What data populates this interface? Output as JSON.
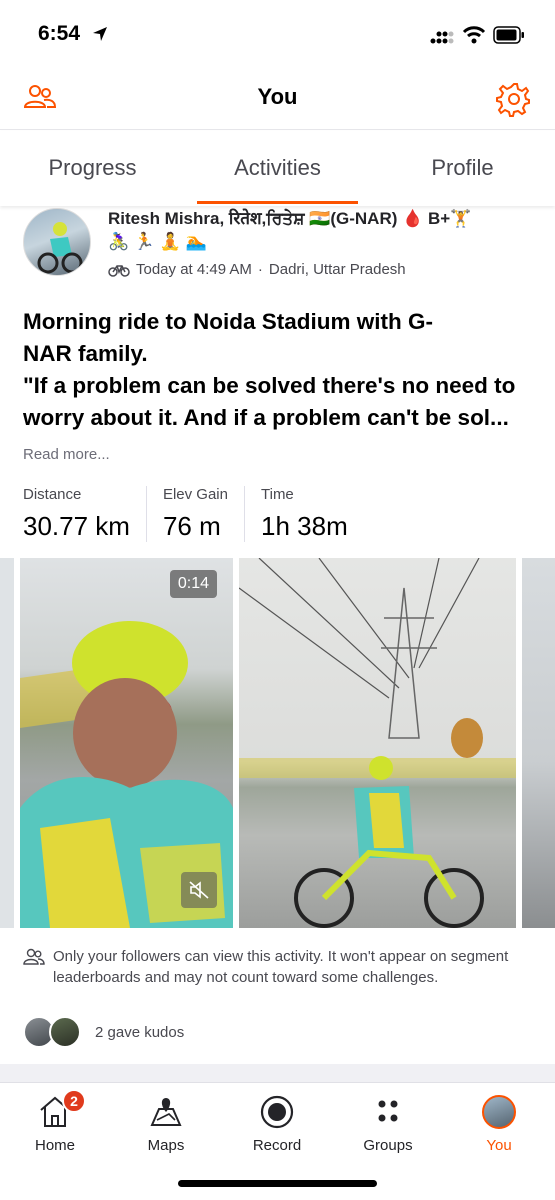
{
  "status_bar": {
    "time": "6:54"
  },
  "header": {
    "title": "You"
  },
  "tabs": [
    {
      "label": "Progress"
    },
    {
      "label": "Activities"
    },
    {
      "label": "Profile"
    }
  ],
  "activity": {
    "athlete_name": "Ritesh Mishra, रितेश,ਰਿਤੇਸ਼ 🇮🇳(G-NAR) 🩸 B+🏋️",
    "sport_emojis": "🚴‍♀️ 🏃 🧘 🏊",
    "timestamp": "Today at 4:49 AM",
    "location": "Dadri, Uttar Pradesh",
    "title": "Morning ride to Noida Stadium with G-\nNAR family.\n\"If a problem can be solved there's no need to\nworry about it. And if a problem can't be sol...",
    "read_more": "Read more...",
    "stats": [
      {
        "label": "Distance",
        "value": "30.77 km"
      },
      {
        "label": "Elev Gain",
        "value": "76 m"
      },
      {
        "label": "Time",
        "value": "1h 38m"
      }
    ],
    "video_duration": "0:14",
    "privacy_note": "Only your followers can view this activity. It won't appear on segment leaderboards and may not count toward some challenges.",
    "kudos_text": "2 gave kudos"
  },
  "bottom_nav": {
    "items": [
      {
        "label": "Home",
        "icon": "home-icon",
        "badge": "2"
      },
      {
        "label": "Maps",
        "icon": "maps-icon"
      },
      {
        "label": "Record",
        "icon": "record-icon"
      },
      {
        "label": "Groups",
        "icon": "groups-icon"
      },
      {
        "label": "You",
        "icon": "avatar"
      }
    ]
  },
  "colors": {
    "accent": "#fc5200",
    "badge": "#e03a1c"
  }
}
